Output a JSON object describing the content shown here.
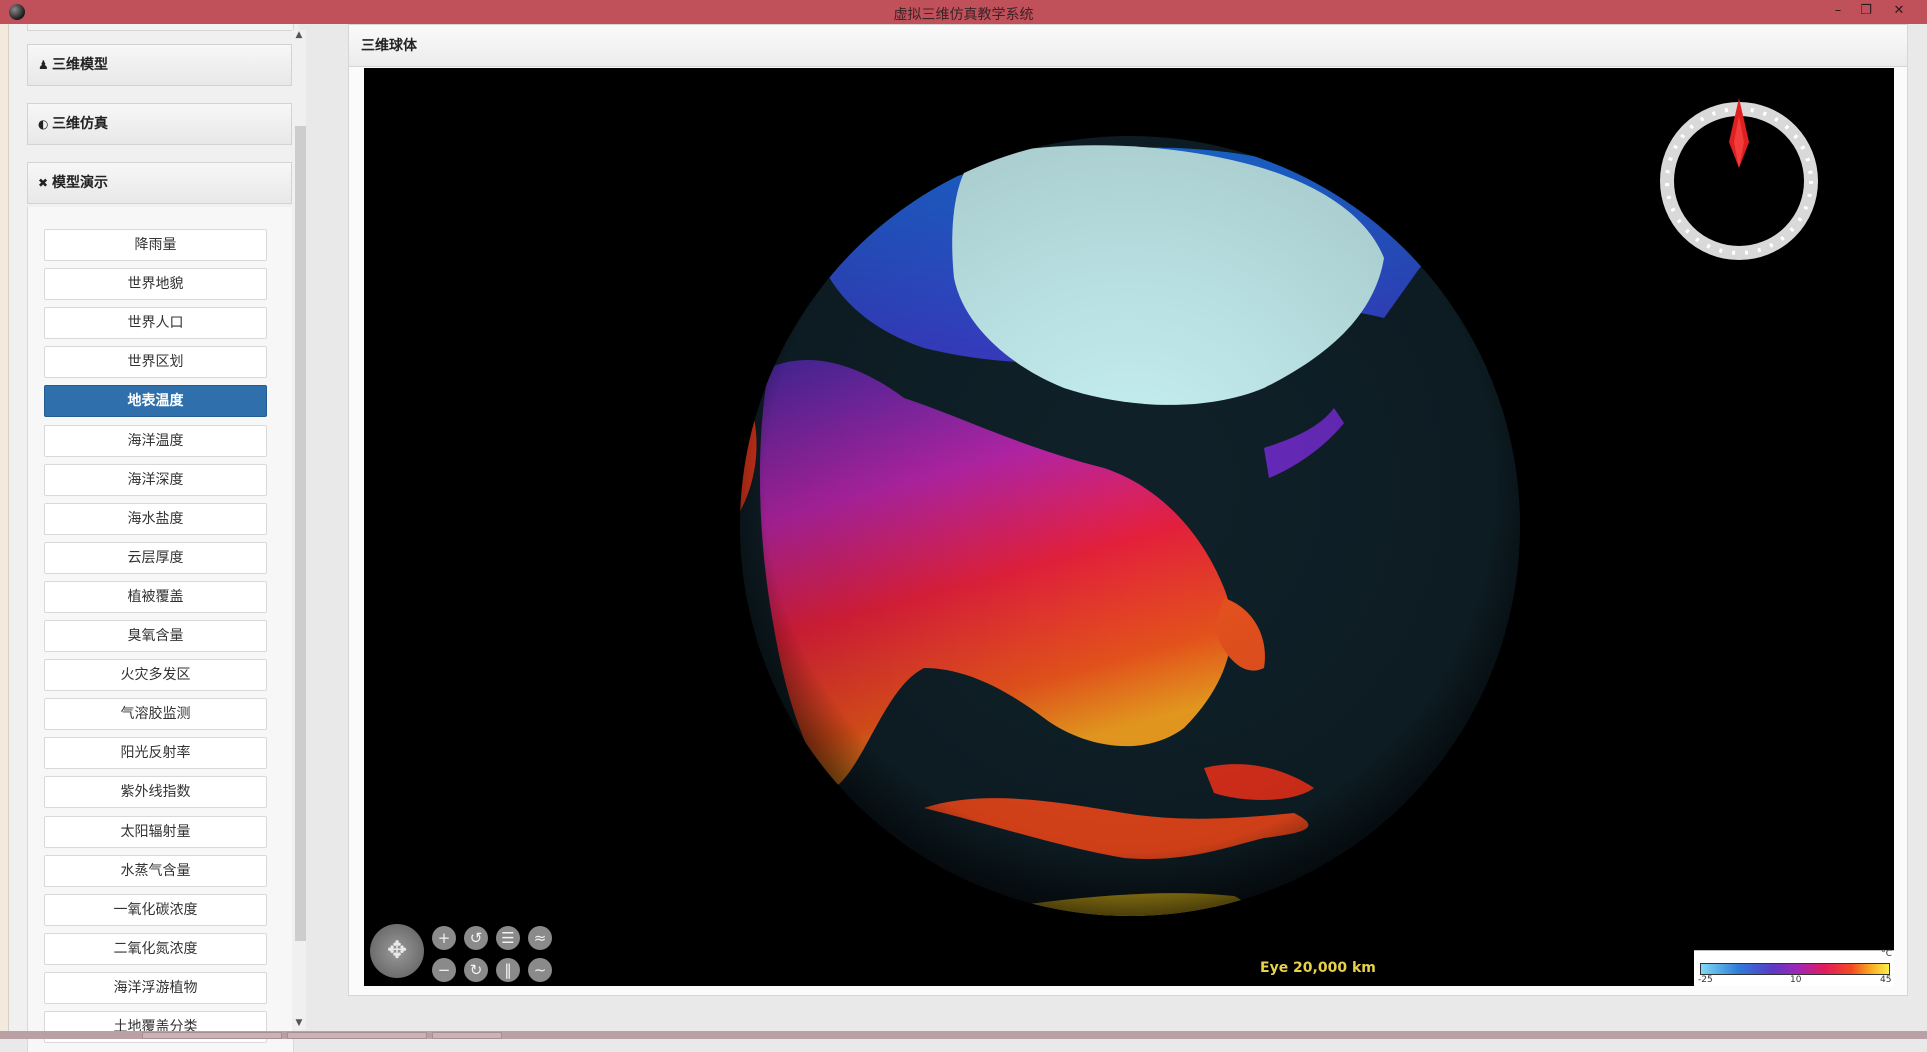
{
  "window": {
    "title": "虚拟三维仿真教学系统",
    "icon": "globe-app-icon",
    "controls": {
      "minimize": "–",
      "restore": "❐",
      "close": "✕"
    }
  },
  "sidebar": {
    "panels": [
      {
        "icon": "model-icon",
        "glyph": "♟",
        "label": "三维模型"
      },
      {
        "icon": "simulation-icon",
        "glyph": "◐",
        "label": "三维仿真"
      },
      {
        "icon": "tools-icon",
        "glyph": "✖",
        "label": "模型演示"
      }
    ],
    "items": [
      "降雨量",
      "世界地貌",
      "世界人口",
      "世界区划",
      "地表温度",
      "海洋温度",
      "海洋深度",
      "海水盐度",
      "云层厚度",
      "植被覆盖",
      "臭氧含量",
      "火灾多发区",
      "气溶胶监测",
      "阳光反射率",
      "紫外线指数",
      "太阳辐射量",
      "水蒸气含量",
      "一氧化碳浓度",
      "二氧化氮浓度",
      "海洋浮游植物",
      "土地覆盖分类"
    ],
    "active_item": "地表温度"
  },
  "main": {
    "header": "三维球体",
    "eye": "Eye  20,000 km",
    "legend": {
      "unit": "°C",
      "min": "-25",
      "mid": "10",
      "max": "45"
    },
    "nav": {
      "pan_glyph": "✥",
      "buttons": [
        "+",
        "↺",
        "☰",
        "≈",
        "−",
        "↻",
        "‖",
        "∼"
      ]
    }
  },
  "colors": {
    "titlebar": "#c0505a",
    "active_item": "#2f6fab",
    "eye_text": "#e8d24a"
  }
}
